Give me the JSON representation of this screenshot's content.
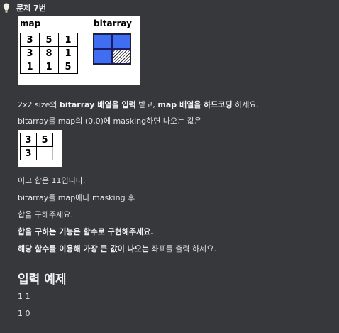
{
  "problem": {
    "title": "문제 7번"
  },
  "figure": {
    "map_label": "map",
    "bitarray_label": "bitarray",
    "map": [
      [
        "3",
        "5",
        "1"
      ],
      [
        "3",
        "8",
        "1"
      ],
      [
        "1",
        "1",
        "5"
      ]
    ],
    "bitarray": [
      [
        1,
        1
      ],
      [
        1,
        0
      ]
    ],
    "colors": {
      "on": "#3f6ff0",
      "off_hatch": "#333333"
    }
  },
  "text": {
    "l1_a": "2x2 size의 ",
    "l1_b": "bitarray 배열을 입력",
    "l1_c": " 받고, ",
    "l1_d": "map 배열을 하드코딩",
    "l1_e": " 하세요.",
    "l2": "bitarray를 map의 (0,0)에 masking하면 나오는 값은",
    "l3": "이고  합은 11입니다.",
    "l4": "bitarray를 map에다 masking 후",
    "l5": "합을 구해주세요.",
    "l6": "합을 구하는 기능은 함수로 구현해주세요.",
    "l7_a": "해당 함수를 이용해 가장 큰 값이 나오는",
    "l7_b": "  좌표를 출력 하세요."
  },
  "result": [
    [
      "3",
      "5"
    ],
    [
      "3",
      ""
    ]
  ],
  "input_example": {
    "title": "입력 예제",
    "lines": [
      "1 1",
      "1 0"
    ]
  }
}
